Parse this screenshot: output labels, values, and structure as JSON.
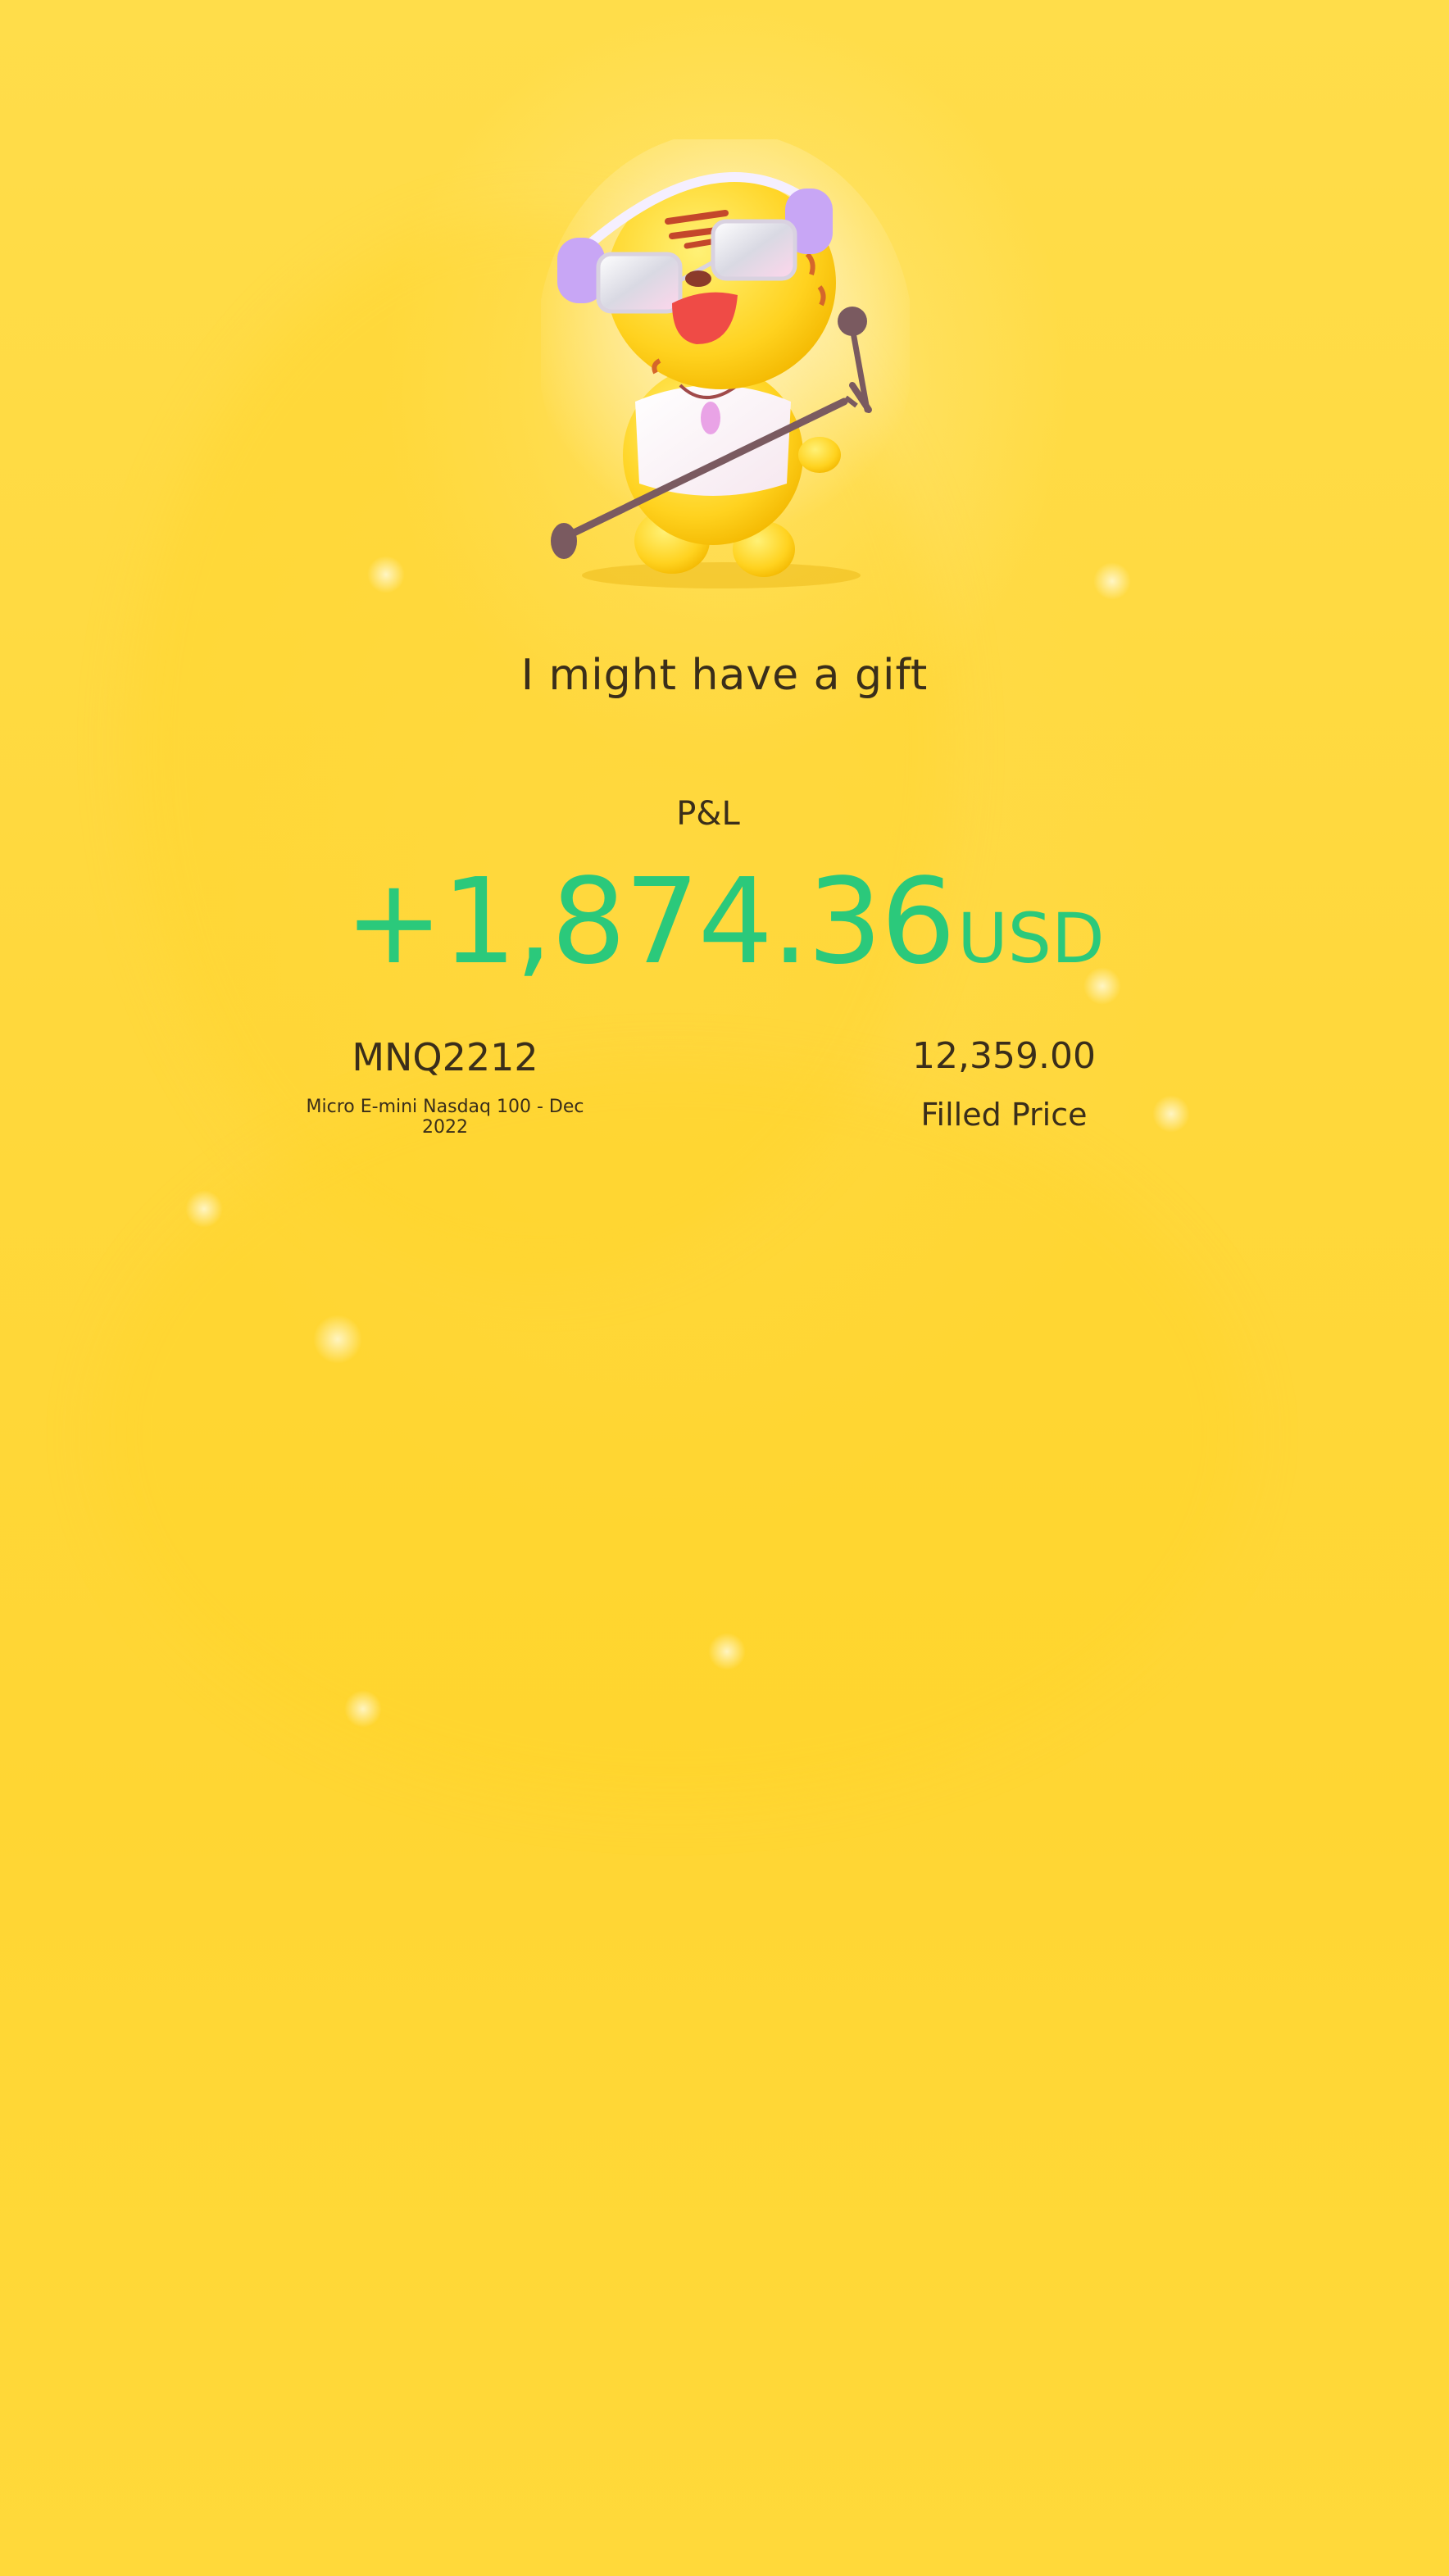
{
  "card": {
    "title": "I might have a gift",
    "mascot": "tiger-mascot-with-headphones-and-microphone"
  },
  "pnl": {
    "label": "P&L",
    "amount": "+1,874.36",
    "currency": "USD"
  },
  "contract": {
    "code": "MNQ2212",
    "name": "Micro E-mini Nasdaq 100 - Dec 2022"
  },
  "price": {
    "value": "12,359.00",
    "label": "Filled Price"
  },
  "colors": {
    "background": "#ffd93b",
    "profit": "#2bc97b",
    "text": "#3a2e1a"
  }
}
